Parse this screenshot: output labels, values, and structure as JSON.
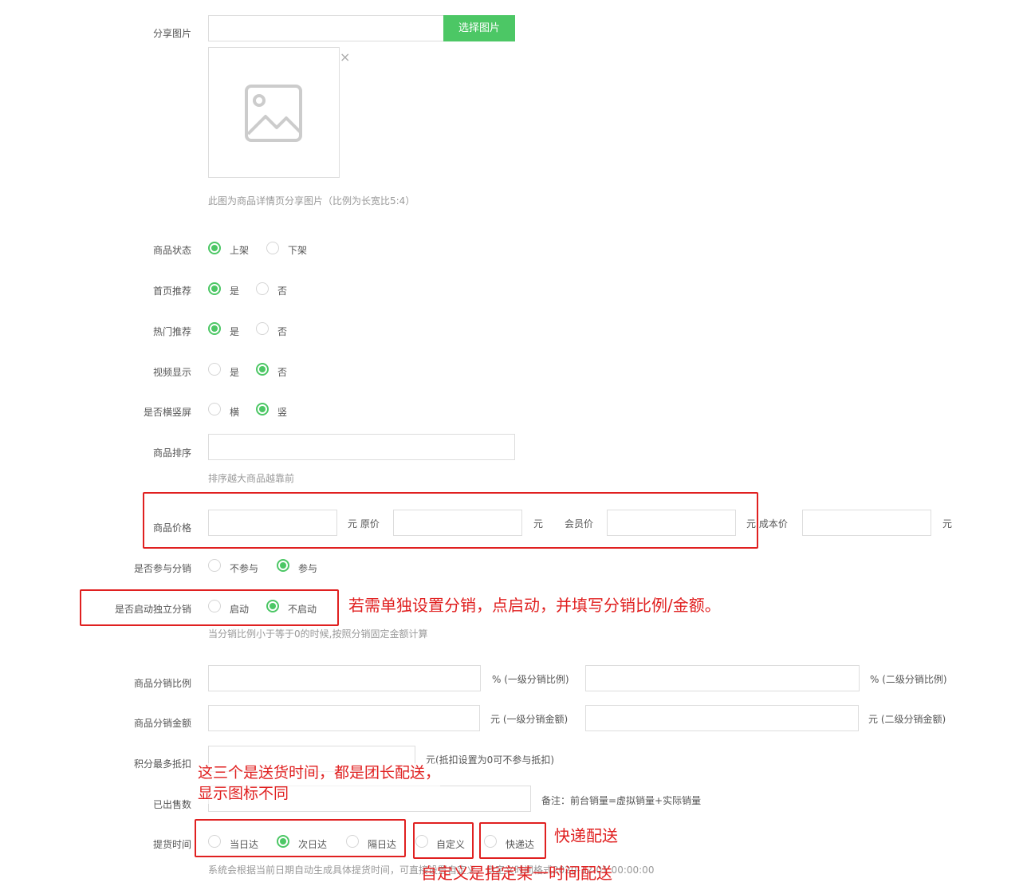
{
  "share_image": {
    "label": "分享图片",
    "button": "选择图片",
    "close": "×",
    "hint": "此图为商品详情页分享图片（比例为长宽比5:4）"
  },
  "status": {
    "label": "商品状态",
    "opt1": "上架",
    "opt2": "下架"
  },
  "home_rec": {
    "label": "首页推荐",
    "opt1": "是",
    "opt2": "否"
  },
  "hot_rec": {
    "label": "热门推荐",
    "opt1": "是",
    "opt2": "否"
  },
  "video": {
    "label": "视频显示",
    "opt1": "是",
    "opt2": "否"
  },
  "orient": {
    "label": "是否横竖屏",
    "opt1": "横",
    "opt2": "竖"
  },
  "sort": {
    "label": "商品排序",
    "hint": "排序越大商品越靠前"
  },
  "price": {
    "label": "商品价格",
    "unit1": "元 原价",
    "unit2": "元",
    "member": "会员价",
    "unit3": "元 成本价",
    "unit4": "元"
  },
  "dist_join": {
    "label": "是否参与分销",
    "opt1": "不参与",
    "opt2": "参与"
  },
  "dist_indep": {
    "label": "是否启动独立分销",
    "opt1": "启动",
    "opt2": "不启动",
    "hint": "当分销比例小于等于0的时候,按照分销固定金额计算"
  },
  "dist_ratio": {
    "label": "商品分销比例",
    "unit1": "% (一级分销比例)",
    "unit2": "% (二级分销比例)"
  },
  "dist_amount": {
    "label": "商品分销金额",
    "unit1": "元 (一级分销金额)",
    "unit2": "元 (二级分销金额)"
  },
  "points": {
    "label": "积分最多抵扣",
    "unit": "元(抵扣设置为0可不参与抵扣)"
  },
  "sold": {
    "label": "已出售数",
    "note": "备注：前台销量=虚拟销量+实际销量"
  },
  "pickup": {
    "label": "提货时间",
    "opt1": "当日达",
    "opt2": "次日达",
    "opt3": "隔日达",
    "opt4": "自定义",
    "opt5": "快递达",
    "hint": "系统会根据当前日期自动生成具体提货时间，可直接设置自定义，自定义时间格式2020-12-01 00:00:00"
  },
  "annotations": {
    "a1": "若需单独设置分销，点启动，并填写分销比例/金额。",
    "a2_line1": "这三个是送货时间，都是团长配送，",
    "a2_line2": "显示图标不同",
    "a3": "快递配送",
    "a4": "自定义是指定某一时间配送"
  },
  "colors": {
    "accent": "#4cc765",
    "annotation": "#e02020"
  }
}
